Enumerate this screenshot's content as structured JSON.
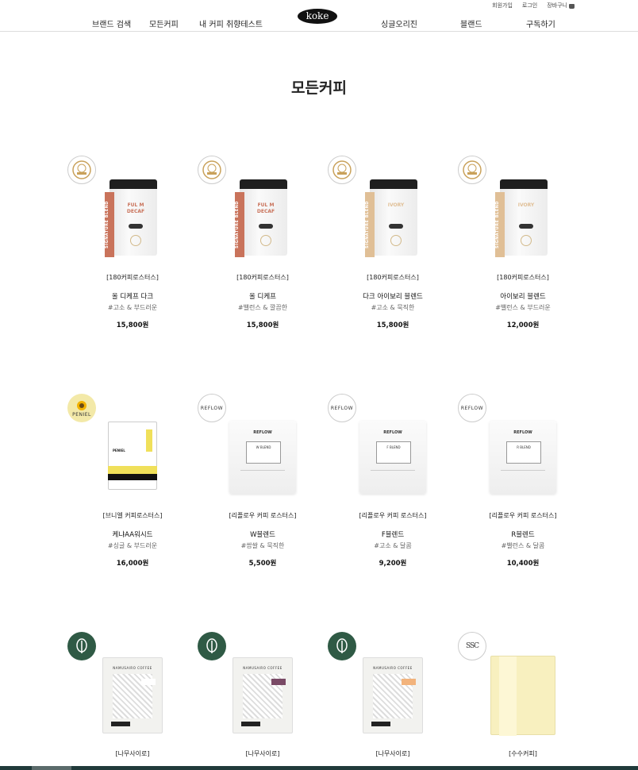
{
  "header": {
    "util": {
      "signup": "회원가입",
      "login": "로그인",
      "cart": "장바구니"
    },
    "nav": {
      "brand_search": "브랜드 검색",
      "all_coffee": "모든커피",
      "my_taste_test": "내 커피 취향테스트",
      "single_origin": "싱글오리진",
      "blend": "블랜드",
      "subscribe": "구독하기"
    },
    "logo": "koke"
  },
  "page": {
    "title": "모든커피"
  },
  "products": [
    {
      "brand": "[180커피로스터스]",
      "name": "올 디케프 다크",
      "tags": "#고소 & 부드러운",
      "price": "15,800원",
      "badge": "award-seal-icon",
      "visual": "can",
      "label": "SIGNATURE BLEND",
      "label_color": "#c9735b",
      "tag_title": "FUL M DECAF"
    },
    {
      "brand": "[180커피로스터스]",
      "name": "올 디케프",
      "tags": "#밸런스 & 깔끔한",
      "price": "15,800원",
      "badge": "award-seal-icon",
      "visual": "can",
      "label": "SIGNATURE BLEND",
      "label_color": "#c9735b",
      "tag_title": "FUL M DECAF"
    },
    {
      "brand": "[180커피로스터스]",
      "name": "다크 아이보리 블렌드",
      "tags": "#고소 & 묵직한",
      "price": "15,800원",
      "badge": "award-seal-icon",
      "visual": "can",
      "label": "SIGNATURE BLEND",
      "label_color": "#e0bf96",
      "tag_title": "IVORY"
    },
    {
      "brand": "[180커피로스터스]",
      "name": "아이보리 블렌드",
      "tags": "#밸런스 & 부드러운",
      "price": "12,000원",
      "badge": "award-seal-icon",
      "visual": "can",
      "label": "SIGNATURE BLEND",
      "label_color": "#e0bf96",
      "tag_title": "IVORY"
    },
    {
      "brand": "[브니엘 커피로스터스]",
      "name": "케냐AA워시드",
      "tags": "#싱글 & 부드러운",
      "price": "16,000원",
      "badge": "sunflower-icon",
      "badge_text": "PENIEL",
      "visual": "peniel"
    },
    {
      "brand": "[리플로우 커피 로스터스]",
      "name": "W블렌드",
      "tags": "#쌉쌀 & 묵직한",
      "price": "5,500원",
      "badge": "reflow-logo-icon",
      "badge_text": "REFLOW",
      "visual": "pouch",
      "pouch_header": "REFLOW",
      "pouch_box": "W BLEND"
    },
    {
      "brand": "[리플로우 커피 로스터스]",
      "name": "F블렌드",
      "tags": "#고소 & 달콤",
      "price": "9,200원",
      "badge": "reflow-logo-icon",
      "badge_text": "REFLOW",
      "visual": "pouch",
      "pouch_header": "REFLOW",
      "pouch_box": "F BLEND"
    },
    {
      "brand": "[리플로우 커피 로스터스]",
      "name": "R블렌드",
      "tags": "#밸런스 & 달콤",
      "price": "10,400원",
      "badge": "reflow-logo-icon",
      "badge_text": "REFLOW",
      "visual": "pouch",
      "pouch_header": "REFLOW",
      "pouch_box": "R BLEND"
    },
    {
      "brand": "[나무사이로]",
      "badge": "leaf-icon",
      "visual": "namu",
      "pouch_header": "NAMUSAIRO COFFEE",
      "chip_color": "#ffffff"
    },
    {
      "brand": "[나무사이로]",
      "badge": "leaf-icon",
      "visual": "namu",
      "pouch_header": "NAMUSAIRO COFFEE",
      "chip_color": "#7a4a66"
    },
    {
      "brand": "[나무사이로]",
      "badge": "leaf-icon",
      "visual": "namu",
      "pouch_header": "NAMUSAIRO COFFEE",
      "chip_color": "#f2b37c"
    },
    {
      "brand": "[수수커피]",
      "badge": "ssc-logo-icon",
      "badge_text": "SSC",
      "visual": "soosoo"
    }
  ],
  "colors": {
    "badge_dark": "#2f5a45",
    "text": "#222222",
    "footer_bar": "#203a3a"
  }
}
